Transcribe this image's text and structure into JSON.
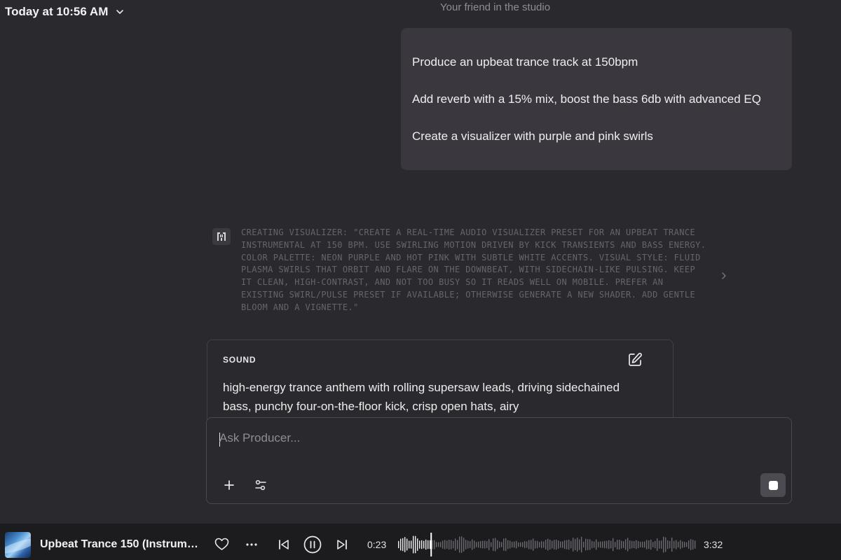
{
  "header": {
    "timestamp": "Today at 10:56 AM",
    "subtitle": "Your friend in the studio"
  },
  "user_message": {
    "lines": [
      "Produce an upbeat trance track at 150bpm",
      "Add reverb with a 15% mix, boost the bass 6db with advanced EQ",
      "Create a visualizer with purple and pink swirls"
    ]
  },
  "tool_call": {
    "icon": "producer-logo-icon",
    "text": "Creating visualizer: \"Create a real-time audio visualizer preset for an upbeat trance instrumental at 150 BPM. Use swirling motion driven by kick transients and bass energy. Color palette: neon purple and hot pink with subtle white accents. Visual style: fluid plasma swirls that orbit and flare on the downbeat, with sidechain-like pulsing. Keep it clean, high-contrast, and not too busy so it reads well on mobile. Prefer an existing swirl/pulse preset if available; otherwise generate a new shader. Add gentle bloom and a vignette.\""
  },
  "sound_card": {
    "label": "SOUND",
    "description": "high-energy trance anthem with rolling supersaw leads, driving sidechained bass, punchy four-on-the-floor kick, crisp open hats, airy"
  },
  "composer": {
    "placeholder": "Ask Producer..."
  },
  "player": {
    "track_title": "Upbeat Trance 150 (Instrume...",
    "elapsed": "0:23",
    "total": "3:32",
    "progress_fraction": 0.108
  },
  "colors": {
    "background": "#2a292d",
    "bubble": "#3a383e",
    "player_bar": "#1c1b1e",
    "muted_text": "#8e8d93"
  }
}
